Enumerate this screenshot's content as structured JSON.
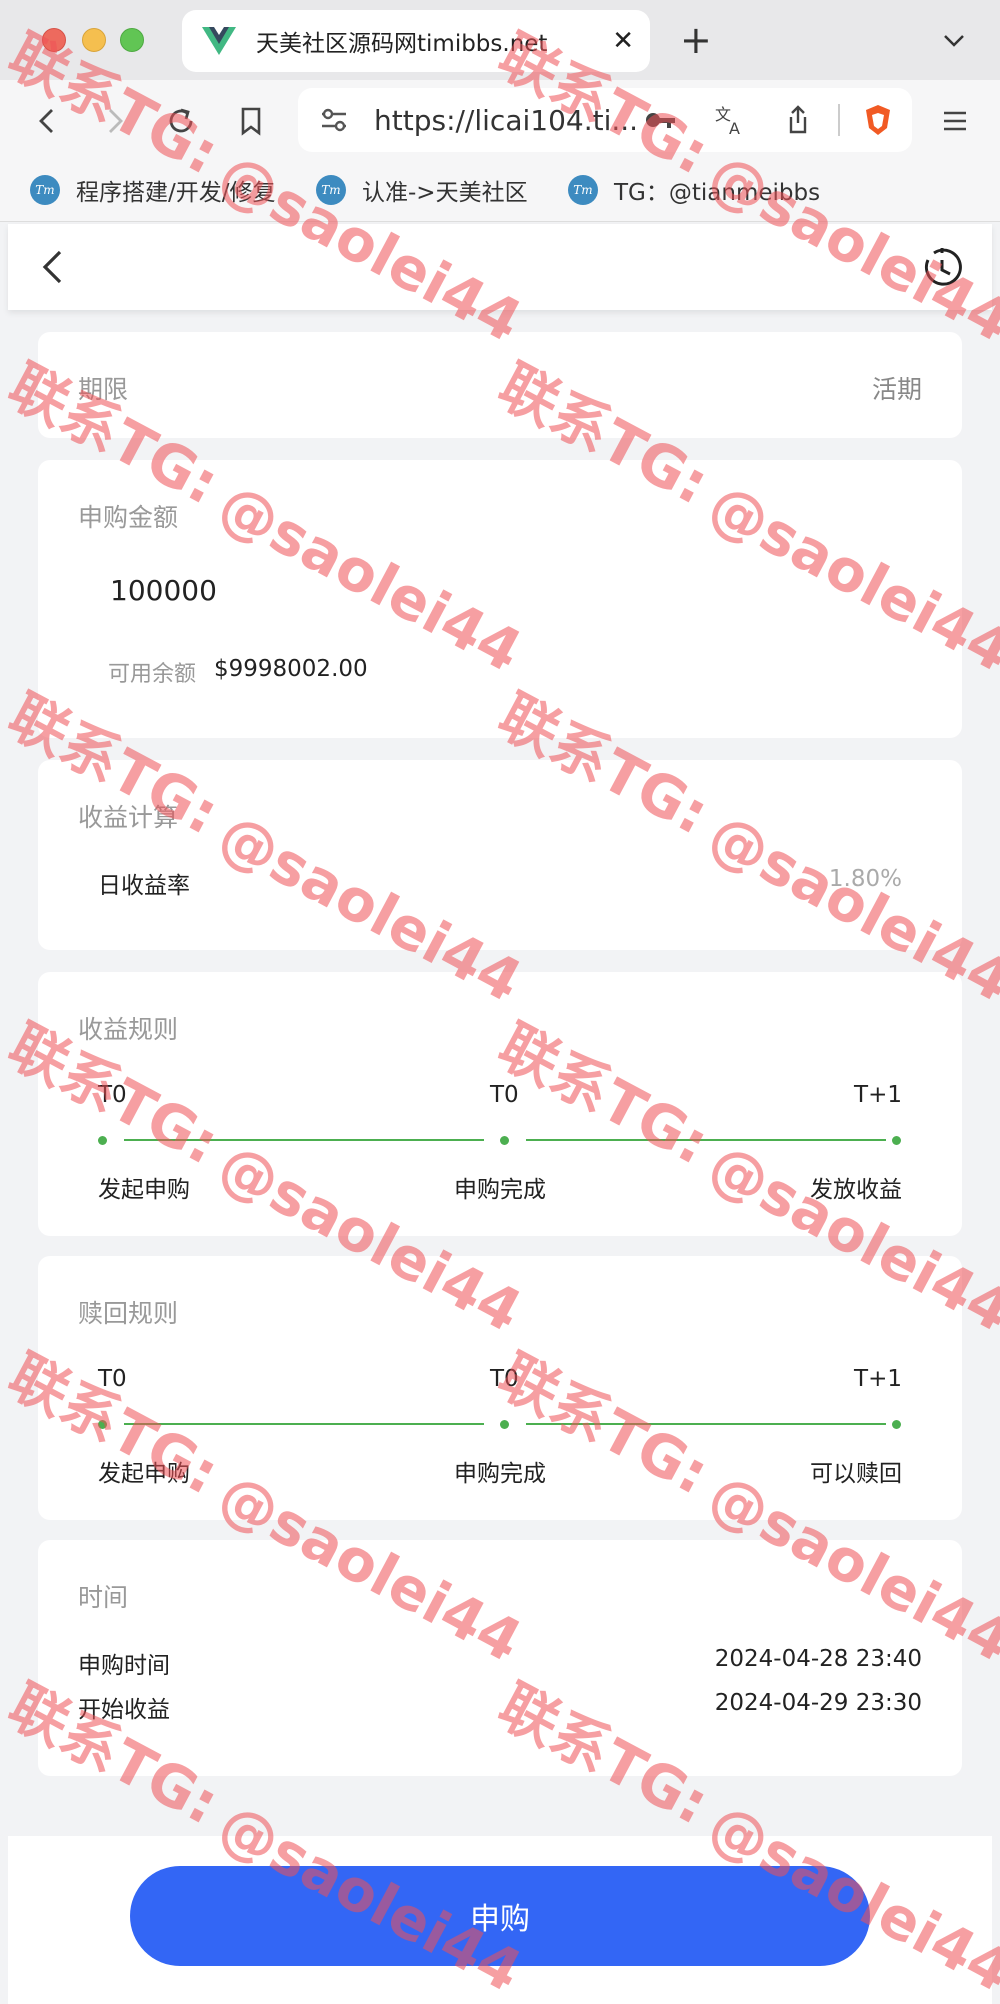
{
  "browser": {
    "tab_title": "天美社区源码网timibbs.net",
    "tab_close": "✕",
    "new_tab": "+",
    "url": "https://licai104.ti...",
    "bookmarks": [
      {
        "label": "程序搭建/开发/修复",
        "icon": "Tm"
      },
      {
        "label": "认准->天美社区",
        "icon": "Tm"
      },
      {
        "label": "TG：@tianmeibbs",
        "icon": "Tm"
      }
    ]
  },
  "term": {
    "label": "期限",
    "value": "活期"
  },
  "purchase": {
    "title": "申购金额",
    "amount": "100000",
    "balance_label": "可用余额",
    "balance_value": "$9998002.00"
  },
  "income_calc": {
    "title": "收益计算",
    "rate_label": "日收益率",
    "rate_value": "1.80%"
  },
  "income_rules": {
    "title": "收益规则",
    "steps": [
      {
        "top": "T0",
        "bottom": "发起申购"
      },
      {
        "top": "T0",
        "bottom": "申购完成"
      },
      {
        "top": "T+1",
        "bottom": "发放收益"
      }
    ]
  },
  "redeem_rules": {
    "title": "赎回规则",
    "steps": [
      {
        "top": "T0",
        "bottom": "发起申购"
      },
      {
        "top": "T0",
        "bottom": "申购完成"
      },
      {
        "top": "T+1",
        "bottom": "可以赎回"
      }
    ]
  },
  "time": {
    "title": "时间",
    "purchase_time_label": "申购时间",
    "purchase_time_value": "2024-04-28 23:40",
    "start_income_label": "开始收益",
    "start_income_value": "2024-04-29 23:30"
  },
  "submit_label": "申购",
  "watermark_line1": "联系TG:",
  "watermark_line2": "@saolei44",
  "colors": {
    "accent": "#3366f5",
    "step_green": "#4caf50",
    "watermark": "#ef5055"
  }
}
